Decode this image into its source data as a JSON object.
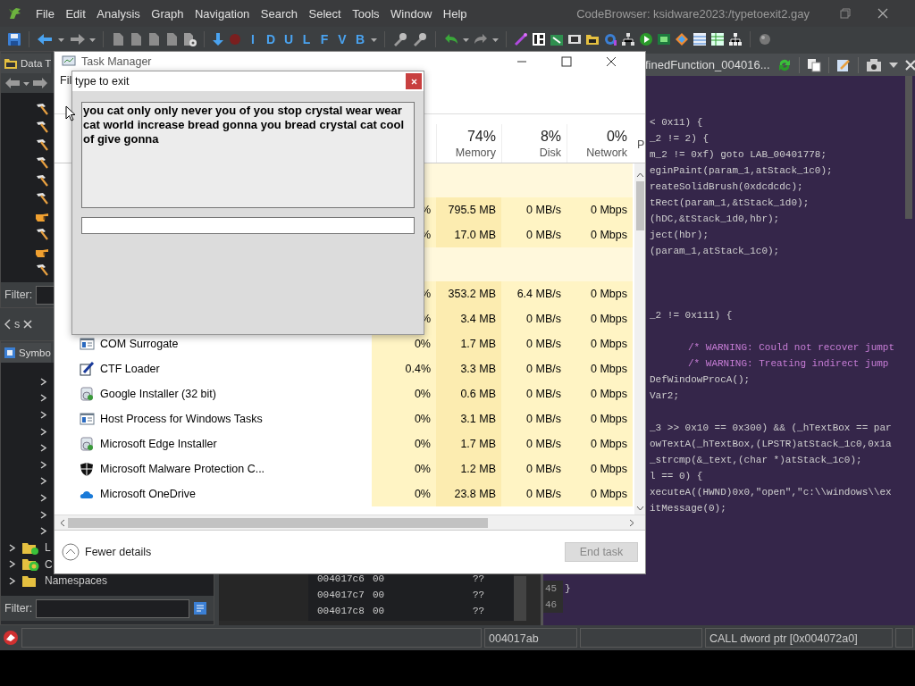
{
  "codebrowser": {
    "menu": [
      "File",
      "Edit",
      "Analysis",
      "Graph",
      "Navigation",
      "Search",
      "Select",
      "Tools",
      "Window",
      "Help"
    ],
    "title": "CodeBrowser: ksidware2023:/typetoexit2.gay",
    "toolbar_letters": [
      "I",
      "D",
      "U",
      "L",
      "F",
      "V",
      "B"
    ],
    "data_types": {
      "tab": "Data T",
      "items": [
        {
          "kind": "hammer"
        },
        {
          "kind": "hammer"
        },
        {
          "kind": "hammer"
        },
        {
          "kind": "hammer"
        },
        {
          "kind": "hammer"
        },
        {
          "kind": "hammer"
        },
        {
          "kind": "hand"
        },
        {
          "kind": "hammer"
        },
        {
          "kind": "hand"
        },
        {
          "kind": "hammer"
        }
      ],
      "filter_label": "Filter:"
    },
    "tab_strip": {
      "tab": "s"
    },
    "symbol_tree": {
      "tab": "Symbo",
      "nodes": [
        {
          "kind": "node",
          "expanded": false
        },
        {
          "kind": "node",
          "expanded": false
        },
        {
          "kind": "node",
          "expanded": false
        },
        {
          "kind": "node",
          "expanded": false
        },
        {
          "kind": "node",
          "expanded": false
        },
        {
          "kind": "node",
          "expanded": false
        },
        {
          "kind": "node",
          "expanded": false
        },
        {
          "kind": "node",
          "expanded": false
        },
        {
          "kind": "node",
          "expanded": false
        },
        {
          "kind": "node",
          "expanded": false
        },
        {
          "kind": "labels",
          "label": "L",
          "expanded": false
        },
        {
          "kind": "classes",
          "label": "C",
          "expanded": false
        },
        {
          "kind": "folder",
          "label": "Namespaces",
          "expanded": false
        }
      ],
      "filter_label": "Filter:"
    },
    "listing": {
      "rows": [
        {
          "address": "004017c6",
          "bytes": "00",
          "value": "??"
        },
        {
          "address": "004017c7",
          "bytes": "00",
          "value": "??"
        },
        {
          "address": "004017c8",
          "bytes": "00",
          "value": "??"
        }
      ]
    },
    "decompiler": {
      "tab": "finedFunction_004016...",
      "lines": [
        {
          "kind": "code",
          "text": "< 0x11) {"
        },
        {
          "kind": "code",
          "text": "_2 != 2) {"
        },
        {
          "kind": "code",
          "text": "m_2 != 0xf) goto LAB_00401778;"
        },
        {
          "kind": "code",
          "text": "eginPaint(param_1,atStack_1c0);"
        },
        {
          "kind": "code",
          "text": "reateSolidBrush(0xdcdcdc);"
        },
        {
          "kind": "code",
          "text": "tRect(param_1,&tStack_1d0);"
        },
        {
          "kind": "code",
          "text": "(hDC,&tStack_1d0,hbr);"
        },
        {
          "kind": "code",
          "text": "ject(hbr);"
        },
        {
          "kind": "code",
          "text": "(param_1,atStack_1c0);"
        },
        {
          "kind": "blank"
        },
        {
          "kind": "blank"
        },
        {
          "kind": "blank"
        },
        {
          "kind": "code",
          "text": "_2 != 0x111) {"
        },
        {
          "kind": "blank"
        },
        {
          "kind": "comment",
          "text": "/* WARNING: Could not recover jumpt"
        },
        {
          "kind": "comment",
          "text": "/* WARNING: Treating indirect jump"
        },
        {
          "kind": "code",
          "text": "DefWindowProcA();"
        },
        {
          "kind": "code",
          "text": "Var2;"
        },
        {
          "kind": "blank"
        },
        {
          "kind": "code",
          "text": "_3 >> 0x10 == 0x300) && (_hTextBox == par"
        },
        {
          "kind": "code",
          "text": "owTextA(_hTextBox,(LPSTR)atStack_1c0,0x1a"
        },
        {
          "kind": "code",
          "text": "_strcmp(&_text,(char *)atStack_1c0);"
        },
        {
          "kind": "code",
          "text": "l == 0) {"
        },
        {
          "kind": "code",
          "text": "xecuteA((HWND)0x0,\"open\",\"c:\\\\windows\\\\ex"
        },
        {
          "kind": "code",
          "text": "itMessage(0);"
        }
      ],
      "numbered_lines": [
        {
          "number": "45",
          "text": "}"
        },
        {
          "number": "46"
        }
      ]
    },
    "status_bar": {
      "address": "004017ab",
      "instruction": "CALL dword ptr [0x004072a0]"
    }
  },
  "task_manager": {
    "title": "Task Manager",
    "menu": [
      "Fil"
    ],
    "columns": [
      {
        "percent": "74%",
        "label": "Memory"
      },
      {
        "percent": "8%",
        "label": "Disk"
      },
      {
        "percent": "0%",
        "label": "Network"
      },
      {
        "label": "P"
      }
    ],
    "rows": [
      {
        "kind": "group"
      },
      {
        "kind": "process",
        "cpu": "%",
        "memory": "795.5 MB",
        "disk": "0 MB/s",
        "network": "0 Mbps"
      },
      {
        "kind": "process",
        "cpu": "%",
        "memory": "17.0 MB",
        "disk": "0 MB/s",
        "network": "0 Mbps"
      },
      {
        "kind": "group"
      },
      {
        "kind": "process",
        "cpu": "%",
        "memory": "353.2 MB",
        "disk": "6.4 MB/s",
        "network": "0 Mbps"
      },
      {
        "kind": "process",
        "cpu": "%",
        "memory": "3.4 MB",
        "disk": "0 MB/s",
        "network": "0 Mbps"
      },
      {
        "kind": "window",
        "name": "COM Surrogate",
        "cpu": "0%",
        "memory": "1.7 MB",
        "disk": "0 MB/s",
        "network": "0 Mbps"
      },
      {
        "kind": "pen",
        "name": "CTF Loader",
        "cpu": "0.4%",
        "memory": "3.3 MB",
        "disk": "0 MB/s",
        "network": "0 Mbps"
      },
      {
        "kind": "installer",
        "name": "Google Installer (32 bit)",
        "cpu": "0%",
        "memory": "0.6 MB",
        "disk": "0 MB/s",
        "network": "0 Mbps"
      },
      {
        "kind": "window",
        "name": "Host Process for Windows Tasks",
        "cpu": "0%",
        "memory": "3.1 MB",
        "disk": "0 MB/s",
        "network": "0 Mbps"
      },
      {
        "kind": "installer",
        "name": "Microsoft Edge Installer",
        "cpu": "0%",
        "memory": "1.7 MB",
        "disk": "0 MB/s",
        "network": "0 Mbps"
      },
      {
        "kind": "shield",
        "name": "Microsoft Malware Protection C...",
        "cpu": "0%",
        "memory": "1.2 MB",
        "disk": "0 MB/s",
        "network": "0 Mbps"
      },
      {
        "kind": "cloud",
        "name": "Microsoft OneDrive",
        "cpu": "0%",
        "memory": "23.8 MB",
        "disk": "0 MB/s",
        "network": "0 Mbps"
      }
    ],
    "fewer_details": "Fewer details",
    "end_task": {
      "label": "End task",
      "disabled": true
    }
  },
  "dialog": {
    "title": "type to exit",
    "message": "you cat only only never you of you stop crystal wear wear cat world increase bread gonna you bread crystal cat cool of give gonna"
  }
}
